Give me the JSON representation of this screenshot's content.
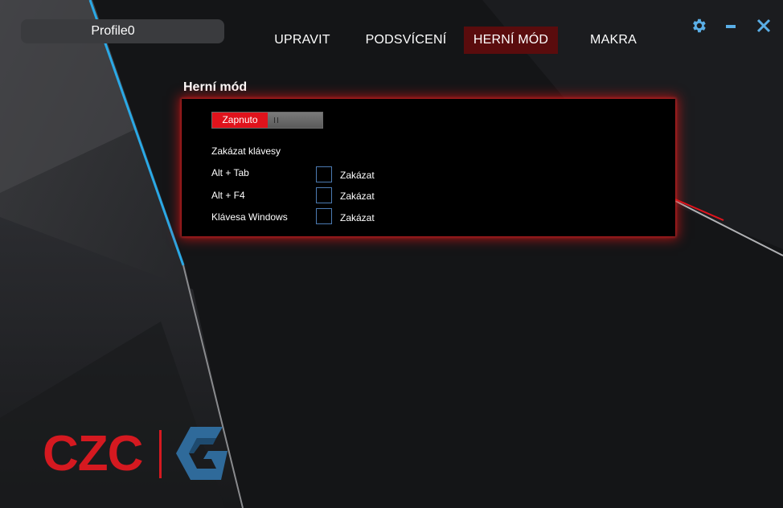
{
  "profile": {
    "name": "Profile0"
  },
  "nav": {
    "tabs": [
      {
        "label": "UPRAVIT",
        "active": false
      },
      {
        "label": "PODSVÍCENÍ",
        "active": false
      },
      {
        "label": "HERNÍ MÓD",
        "active": true
      },
      {
        "label": "MAKRA",
        "active": false
      }
    ]
  },
  "window": {
    "settings_icon": "gear-icon",
    "minimize_icon": "minimize-icon",
    "close_icon": "close-icon"
  },
  "game_mode": {
    "title": "Herní mód",
    "toggle": {
      "on_label": "Zapnuto",
      "state": "on"
    },
    "disable_keys_heading": "Zakázat klávesy",
    "keys": [
      {
        "label": "Alt + Tab",
        "checkbox_label": "Zakázat",
        "checked": false
      },
      {
        "label": "Alt + F4",
        "checkbox_label": "Zakázat",
        "checked": false
      },
      {
        "label": "Klávesa Windows",
        "checkbox_label": "Zakázat",
        "checked": false
      }
    ]
  },
  "brand": {
    "logo_text": "CZC"
  },
  "colors": {
    "accent_red": "#e0131c",
    "active_tab_bg": "#5a0c0d",
    "icon_blue": "#5aaee6",
    "checkbox_border": "#4c7bb2",
    "logo_blue": "#2f6a9a"
  }
}
